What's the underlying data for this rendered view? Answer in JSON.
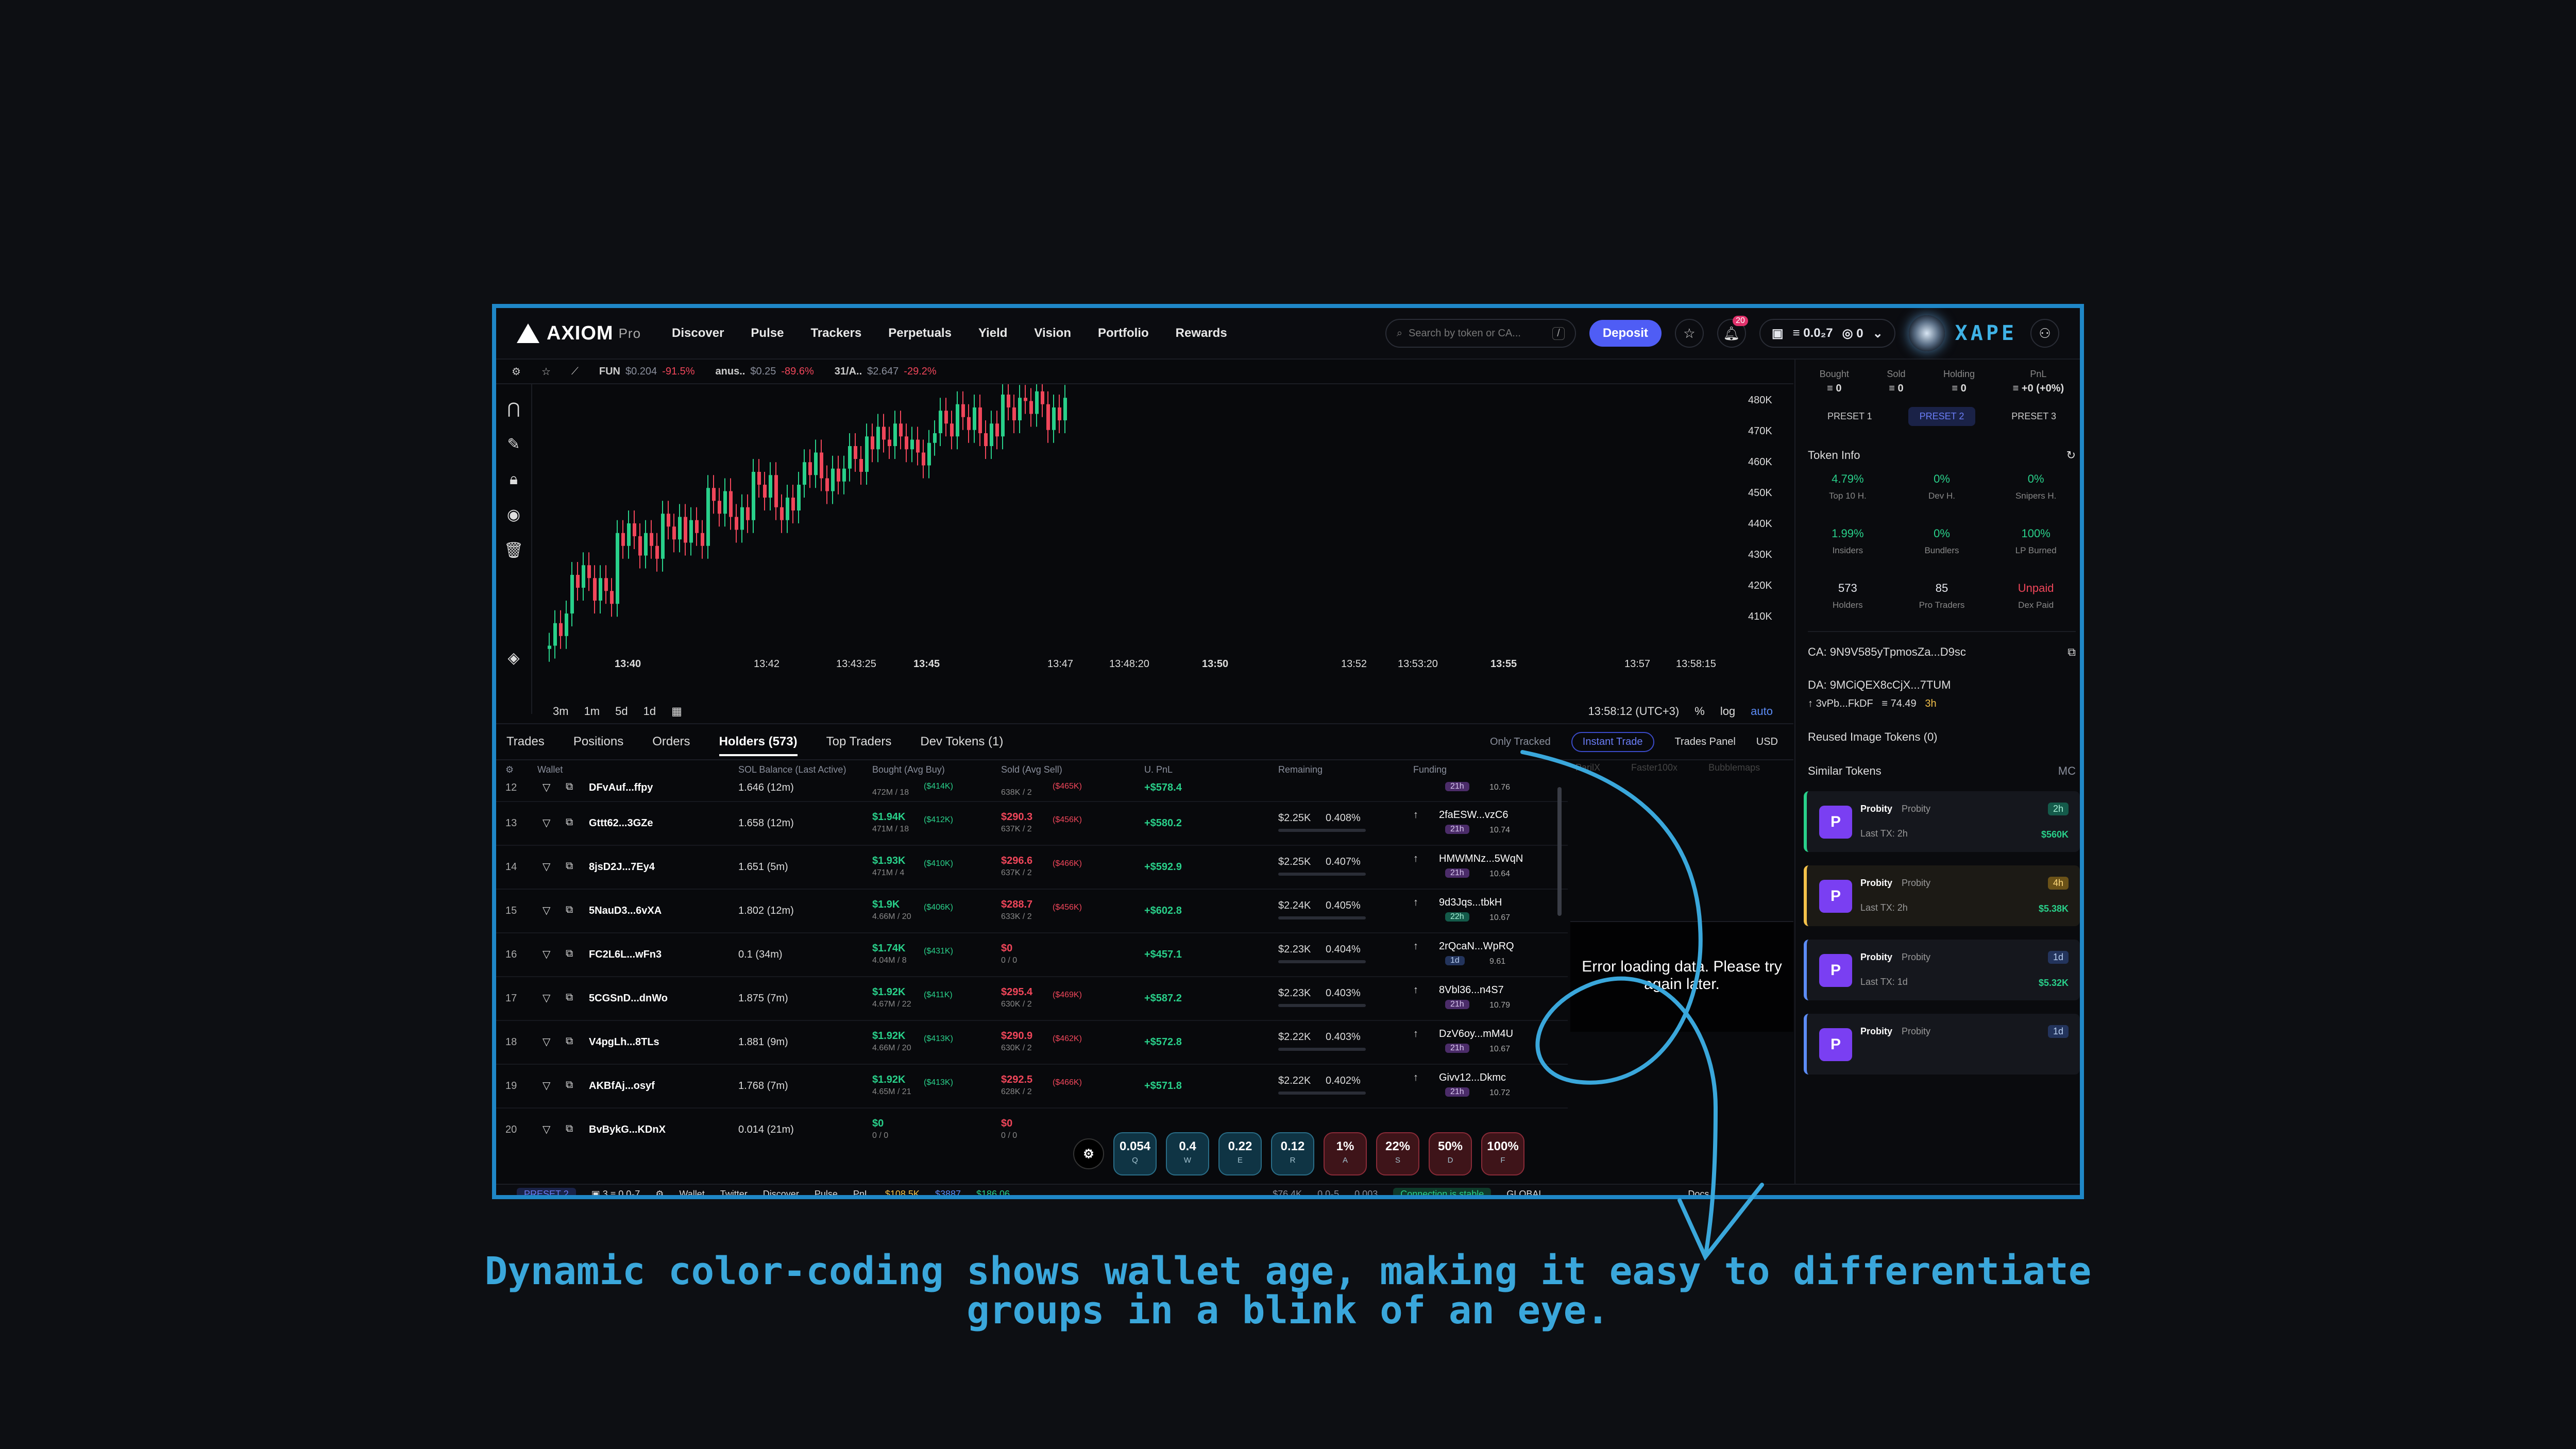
{
  "caption": {
    "line1": "Dynamic color-coding shows wallet age, making it easy to differentiate",
    "line2": "groups in a blink of an eye."
  },
  "nav": {
    "brand": "AXIOM",
    "brand_suffix": "Pro",
    "links": [
      "Discover",
      "Pulse",
      "Trackers",
      "Perpetuals",
      "Yield",
      "Vision",
      "Portfolio",
      "Rewards"
    ],
    "search_placeholder": "Search by token or CA...",
    "search_shortcut": "/",
    "deposit": "Deposit",
    "notif_count": "20",
    "wallet_balance": "0.0₂7",
    "wallet_count": "0",
    "user": "XAPE"
  },
  "tickers": [
    {
      "name": "FUN",
      "price": "$0.204",
      "change": "-91.5%"
    },
    {
      "name": "anus..",
      "price": "$0.25",
      "change": "-89.6%"
    },
    {
      "name": "31/A..",
      "price": "$2.647",
      "change": "-29.2%"
    }
  ],
  "price_axis": [
    "480K",
    "470K",
    "460K",
    "450K",
    "440K",
    "430K",
    "420K",
    "410K"
  ],
  "time_axis": [
    "13:40",
    "13:42",
    "13:43:25",
    "13:45",
    "13:47",
    "13:48:20",
    "13:50",
    "13:52",
    "13:53:20",
    "13:55",
    "13:57",
    "13:58:15"
  ],
  "chart_controls": {
    "intervals": [
      "3m",
      "1m",
      "5d",
      "1d"
    ],
    "clock": "13:58:12 (UTC+3)",
    "pct": "%",
    "log": "log",
    "auto": "auto"
  },
  "tabs": {
    "items": [
      "Trades",
      "Positions",
      "Orders",
      "Holders (573)",
      "Top Traders",
      "Dev Tokens (1)"
    ],
    "active": "Holders (573)",
    "only_tracked": "Only Tracked",
    "instant": "Instant Trade",
    "trades_panel": "Trades Panel",
    "usd": "USD"
  },
  "columns": [
    "Wallet",
    "SOL Balance (Last Active)",
    "Bought (Avg Buy)",
    "Sold (Avg Sell)",
    "U. PnL",
    "Remaining",
    "Funding"
  ],
  "holders": [
    {
      "no": "13",
      "wallet": "Gttt62...3GZe",
      "sol": "1.658 (12m)",
      "bought": "$1.94K",
      "bought2": "471M / 18",
      "bavg": "($412K)",
      "sold": "$290.3",
      "sold2": "637K / 2",
      "savg": "($456K)",
      "pnl": "+$580.2",
      "rem": "$2.25K",
      "pct": "0.408%",
      "fname": "2faESW...vzC6",
      "fage": "21h",
      "fsol": "10.74",
      "tone": "purple"
    },
    {
      "no": "14",
      "wallet": "8jsD2J...7Ey4",
      "sol": "1.651 (5m)",
      "bought": "$1.93K",
      "bought2": "471M / 4",
      "bavg": "($410K)",
      "sold": "$296.6",
      "sold2": "637K / 2",
      "savg": "($466K)",
      "pnl": "+$592.9",
      "rem": "$2.25K",
      "pct": "0.407%",
      "fname": "HMWMNz...5WqN",
      "fage": "21h",
      "fsol": "10.64",
      "tone": "purple"
    },
    {
      "no": "15",
      "wallet": "5NauD3...6vXA",
      "sol": "1.802 (12m)",
      "bought": "$1.9K",
      "bought2": "4.66M / 20",
      "bavg": "($406K)",
      "sold": "$288.7",
      "sold2": "633K / 2",
      "savg": "($456K)",
      "pnl": "+$602.8",
      "rem": "$2.24K",
      "pct": "0.405%",
      "fname": "9d3Jqs...tbkH",
      "fage": "22h",
      "fsol": "10.67",
      "tone": "teal"
    },
    {
      "no": "16",
      "wallet": "FC2L6L...wFn3",
      "sol": "0.1 (34m)",
      "bought": "$1.74K",
      "bought2": "4.04M / 8",
      "bavg": "($431K)",
      "sold": "$0",
      "sold2": "0 / 0",
      "savg": "",
      "pnl": "+$457.1",
      "rem": "$2.23K",
      "pct": "0.404%",
      "fname": "2rQcaN...WpRQ",
      "fage": "1d",
      "fsol": "9.61",
      "tone": "navy"
    },
    {
      "no": "17",
      "wallet": "5CGSnD...dnWo",
      "sol": "1.875 (7m)",
      "bought": "$1.92K",
      "bought2": "4.67M / 22",
      "bavg": "($411K)",
      "sold": "$295.4",
      "sold2": "630K / 2",
      "savg": "($469K)",
      "pnl": "+$587.2",
      "rem": "$2.23K",
      "pct": "0.403%",
      "fname": "8Vbl36...n4S7",
      "fage": "21h",
      "fsol": "10.79",
      "tone": "purple"
    },
    {
      "no": "18",
      "wallet": "V4pgLh...8TLs",
      "sol": "1.881 (9m)",
      "bought": "$1.92K",
      "bought2": "4.66M / 20",
      "bavg": "($413K)",
      "sold": "$290.9",
      "sold2": "630K / 2",
      "savg": "($462K)",
      "pnl": "+$572.8",
      "rem": "$2.22K",
      "pct": "0.403%",
      "fname": "DzV6oy...mM4U",
      "fage": "21h",
      "fsol": "10.67",
      "tone": "purple"
    },
    {
      "no": "19",
      "wallet": "AKBfAj...osyf",
      "sol": "1.768 (7m)",
      "bought": "$1.92K",
      "bought2": "4.65M / 21",
      "bavg": "($413K)",
      "sold": "$292.5",
      "sold2": "628K / 2",
      "savg": "($466K)",
      "pnl": "+$571.8",
      "rem": "$2.22K",
      "pct": "0.402%",
      "fname": "Givv12...Dkmc",
      "fage": "21h",
      "fsol": "10.72",
      "tone": "purple"
    },
    {
      "no": "20",
      "wallet": "BvBykG...KDnX",
      "sol": "0.014 (21m)",
      "bought": "$0",
      "bought2": "0 / 0",
      "bavg": "",
      "sold": "$0",
      "sold2": "0 / 0",
      "savg": "",
      "pnl": "",
      "rem": "",
      "pct": "",
      "fname": "",
      "fage": "",
      "fsol": "",
      "tone": "purple"
    }
  ],
  "row12": {
    "no": "12",
    "wallet": "DFvAuf...ffpy",
    "sol": "1.646 (12m)",
    "bought2": "472M / 18",
    "bavg": "($414K)",
    "sold2": "638K / 2",
    "savg": "($465K)",
    "pnl": "+$578.4",
    "fage": "21h",
    "fsol": "10.76"
  },
  "error": "Error loading data. Please try again later.",
  "ghost_cols": [
    "ParilX",
    "Faster100x",
    "Bubblemaps"
  ],
  "right": {
    "stats": [
      {
        "l": "Bought",
        "v": "0"
      },
      {
        "l": "Sold",
        "v": "0"
      },
      {
        "l": "Holding",
        "v": "0"
      },
      {
        "l": "PnL",
        "v": "+0 (+0%)"
      }
    ],
    "presets": [
      "PRESET 1",
      "PRESET 2",
      "PRESET 3"
    ],
    "token_info": "Token Info",
    "metrics": [
      {
        "v": "4.79%",
        "l": "Top 10 H."
      },
      {
        "v": "0%",
        "l": "Dev H."
      },
      {
        "v": "0%",
        "l": "Snipers H."
      },
      {
        "v": "1.99%",
        "l": "Insiders"
      },
      {
        "v": "0%",
        "l": "Bundlers"
      },
      {
        "v": "100%",
        "l": "LP Burned"
      },
      {
        "v": "573",
        "l": "Holders"
      },
      {
        "v": "85",
        "l": "Pro Traders"
      },
      {
        "v": "Unpaid",
        "l": "Dex Paid"
      }
    ],
    "ca": "CA: 9N9V585yTpmosZa...D9sc",
    "da": "DA: 9MCiQEX8cCjX...7TUM",
    "dev": "3vPb...FkDF",
    "dev_sol": "74.49",
    "dev_age": "3h",
    "reused": "Reused Image Tokens (0)",
    "similar": "Similar Tokens",
    "mc": "MC",
    "cards": [
      {
        "name": "Probity",
        "sub": "Probity",
        "last": "Last TX: 2h",
        "age": "2h",
        "mc": "$560K"
      },
      {
        "name": "Probity",
        "sub": "Probity",
        "last": "Last TX: 2h",
        "age": "4h",
        "mc": "$5.38K"
      },
      {
        "name": "Probity",
        "sub": "Probity",
        "last": "Last TX: 1d",
        "age": "1d",
        "mc": "$5.32K"
      },
      {
        "name": "Probity",
        "sub": "Probity",
        "last": "",
        "age": "1d",
        "mc": ""
      }
    ]
  },
  "hotkeys": [
    {
      "v": "0.054",
      "k": "Q"
    },
    {
      "v": "0.4",
      "k": "W"
    },
    {
      "v": "0.22",
      "k": "E"
    },
    {
      "v": "0.12",
      "k": "R"
    },
    {
      "v": "1%",
      "k": "A"
    },
    {
      "v": "22%",
      "k": "S"
    },
    {
      "v": "50%",
      "k": "D"
    },
    {
      "v": "100%",
      "k": "F"
    }
  ],
  "bottom": {
    "preset": "PRESET 2",
    "count": "3",
    "bal": "0.0₂7",
    "wallet": "Wallet",
    "twitter": "Twitter",
    "discover": "Discover",
    "pulse": "Pulse",
    "pnl": "PnL",
    "btc": "$108.5K",
    "eth": "$3887",
    "sol": "$186.06",
    "vol": "$76.4K",
    "fee1": "0.0₂5",
    "fee2": "0.003",
    "conn": "Connection is stable",
    "region": "GLOBAL",
    "docs": "Docs"
  },
  "chart_data": {
    "type": "candlestick",
    "ylim": [
      405000,
      485000
    ],
    "note_values_k": [
      412,
      428,
      425,
      440,
      438,
      445,
      441,
      452,
      448,
      456,
      450,
      462,
      458,
      466,
      470,
      472,
      468,
      475,
      478,
      474,
      480,
      483,
      479
    ]
  }
}
